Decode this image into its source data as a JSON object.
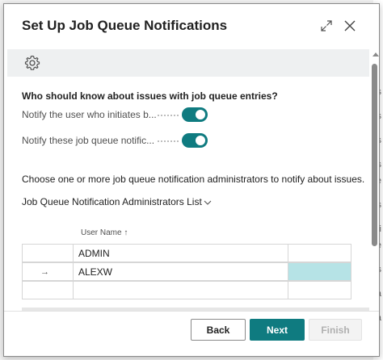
{
  "dialog": {
    "title": "Set Up Job Queue Notifications"
  },
  "header_icons": [
    "expand-icon",
    "close-icon"
  ],
  "toolbar": {
    "icon": "gear-icon"
  },
  "question": "Who should know about issues with job queue entries?",
  "fields": [
    {
      "label": "Notify the user who initiates b...",
      "value": "on"
    },
    {
      "label": "Notify these job queue notific...",
      "value": "on"
    }
  ],
  "instruction": "Choose one or more job queue notification administrators to notify about issues.",
  "part_title": "Job Queue Notification Administrators List",
  "grid": {
    "column_header": "User Name",
    "sort_indicator": "↑",
    "rows": [
      {
        "user_name": "ADMIN",
        "current": false
      },
      {
        "user_name": "ALEXW",
        "current": true,
        "arrow": "→"
      },
      {
        "user_name": "",
        "current": false
      }
    ]
  },
  "buttons": {
    "back": "Back",
    "next": "Next",
    "finish": "Finish"
  },
  "background_fragments": [
    "s",
    "s",
    "s",
    "s",
    "e",
    "s",
    "i",
    "e",
    "s",
    "a",
    "a"
  ],
  "colors": {
    "accent": "#0f7b80",
    "selected_cell": "#b6e3e6"
  }
}
